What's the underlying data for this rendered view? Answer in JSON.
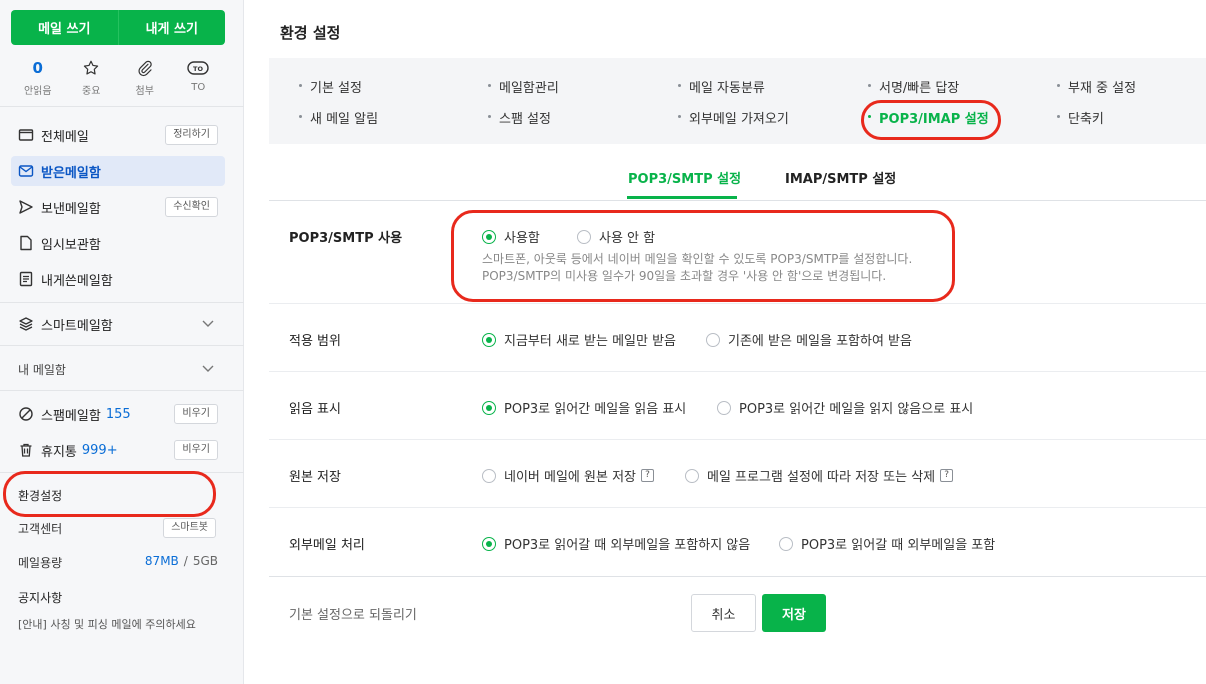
{
  "sidebar": {
    "write_mail": "메일 쓰기",
    "write_self": "내게 쓰기",
    "quick": [
      {
        "value": "0",
        "label": "안읽음"
      },
      {
        "icon": "star-icon",
        "label": "중요"
      },
      {
        "icon": "paperclip-icon",
        "label": "첨부"
      },
      {
        "icon": "to-icon",
        "icon_text": "TO",
        "label": "TO"
      }
    ],
    "folders": {
      "all": "전체메일",
      "all_action": "정리하기",
      "inbox": "받은메일함",
      "sent": "보낸메일함",
      "sent_action": "수신확인",
      "drafts": "임시보관함",
      "self": "내게쓴메일함",
      "smart": "스마트메일함",
      "my_mailbox": "내 메일함",
      "spam": "스팸메일함",
      "spam_count": "155",
      "spam_action": "비우기",
      "trash": "휴지통",
      "trash_count": "999+",
      "trash_action": "비우기"
    },
    "settings": "환경설정",
    "support": "고객센터",
    "support_action": "스마트봇",
    "storage_label": "메일용량",
    "storage_used": "87MB",
    "storage_sep": "/",
    "storage_total": "5GB",
    "notice_title": "공지사항",
    "notice_text": "[안내] 사칭 및 피싱 메일에 주의하세요"
  },
  "main": {
    "title": "환경 설정",
    "menu": [
      "기본 설정",
      "메일함관리",
      "메일 자동분류",
      "서명/빠른 답장",
      "부재 중 설정",
      "새 메일 알림",
      "스팸 설정",
      "외부메일 가져오기",
      "POP3/IMAP 설정",
      "단축키"
    ],
    "subtabs": [
      "POP3/SMTP 설정",
      "IMAP/SMTP 설정"
    ],
    "rows": {
      "use": {
        "label": "POP3/SMTP 사용",
        "opt1": "사용함",
        "opt2": "사용 안 함",
        "desc1": "스마트폰, 아웃룩 등에서 네이버 메일을 확인할 수 있도록 POP3/SMTP를 설정합니다.",
        "desc2": "POP3/SMTP의 미사용 일수가 90일을 초과할 경우 '사용 안 함'으로 변경됩니다."
      },
      "scope": {
        "label": "적용 범위",
        "opt1": "지금부터 새로 받는 메일만 받음",
        "opt2": "기존에 받은 메일을 포함하여 받음"
      },
      "read": {
        "label": "읽음 표시",
        "opt1": "POP3로 읽어간 메일을 읽음 표시",
        "opt2": "POP3로 읽어간 메일을 읽지 않음으로 표시"
      },
      "origin": {
        "label": "원본 저장",
        "opt1": "네이버 메일에 원본 저장",
        "opt2": "메일 프로그램 설정에 따라 저장 또는 삭제",
        "help": "?"
      },
      "external": {
        "label": "외부메일 처리",
        "opt1": "POP3로 읽어갈 때 외부메일을 포함하지 않음",
        "opt2": "POP3로 읽어갈 때 외부메일을 포함"
      }
    },
    "reset": "기본 설정으로 되돌리기",
    "cancel": "취소",
    "save": "저장"
  },
  "colors": {
    "accent": "#08b34a",
    "link_blue": "#0a6dd6",
    "highlight_red": "#e8291c"
  }
}
